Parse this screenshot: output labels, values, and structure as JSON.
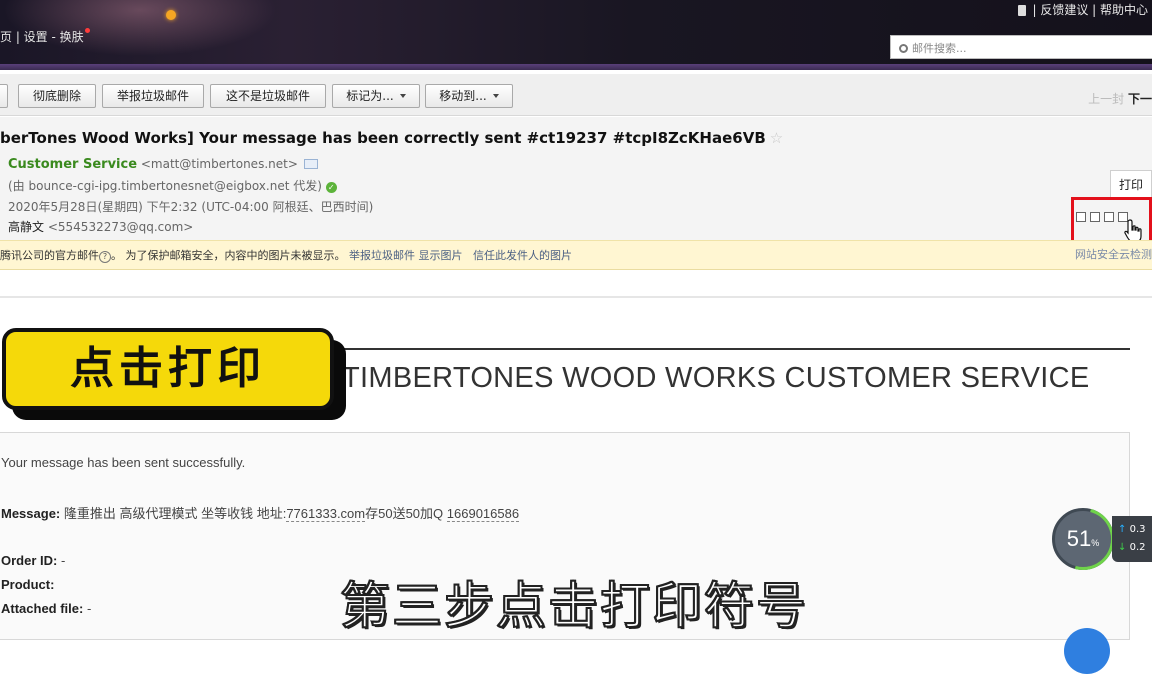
{
  "header": {
    "left_links": "页 | 设置 - 换肤",
    "right_links": "| 反馈建议 | 帮助中心",
    "search_placeholder": "邮件搜索..."
  },
  "toolbar": {
    "buttons": [
      {
        "label": "彻底删除"
      },
      {
        "label": "举报垃圾邮件"
      },
      {
        "label": "这不是垃圾邮件"
      },
      {
        "label": "标记为..."
      },
      {
        "label": "移动到..."
      }
    ],
    "prev": "上一封",
    "next": "下一"
  },
  "mail": {
    "subject": "berTones Wood Works] Your message has been correctly sent #ct19237 #tcpI8ZcKHae6VB",
    "from_name": "Customer Service",
    "from_addr": "<matt@timbertones.net>",
    "via": "(由 bounce-cgi-ipg.timbertonesnet@eigbox.net 代发)",
    "date": "2020年5月28日(星期四) 下午2:32 (UTC-04:00 阿根廷、巴西时间)",
    "to_name": "高静文",
    "to_addr": "<554532273@qq.com>",
    "print_label": "打印"
  },
  "notice": {
    "text": "腾讯公司的官方邮件",
    "help": "?",
    "text2": "。 为了保护邮箱安全，内容中的图片未被显示。",
    "link1": "举报垃圾邮件",
    "link2": "显示图片",
    "link3": "信任此发件人的图片",
    "right": "网站安全云检测"
  },
  "body": {
    "brand": "TIMBERTONES WOOD WORKS CUSTOMER SERVICE",
    "line1": "Your message has been sent successfully.",
    "message_label": "Message:",
    "message_text": "隆重推出 高级代理模式 坐等收钱 地址:",
    "message_link": "7761333.com",
    "message_text2": "存50送50加Q",
    "message_qq": "1669016586",
    "order_label": "Order ID:",
    "order_value": "-",
    "product_label": "Product:",
    "attached_label": "Attached file:",
    "attached_value": "-"
  },
  "overlay": {
    "tag": "点击打印",
    "subtitle": "第三步点击打印符号",
    "gauge_value": "51",
    "gauge_unit": "%",
    "net_up": "0.3",
    "net_down": "0.2"
  }
}
